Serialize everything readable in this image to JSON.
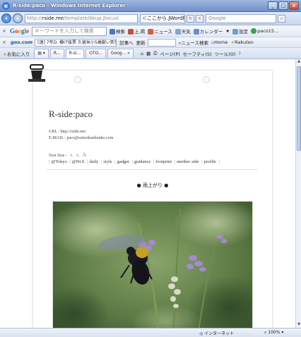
{
  "window": {
    "title": "R-side:paco - Windows Internet Explorer",
    "buttons": {
      "minimize": "_",
      "maximize": "□",
      "close": "×"
    }
  },
  "address": {
    "url_prefix": "http://",
    "url_host": "rside.me",
    "url_path": "/template/bkup.jbicusl",
    "hint": "＜ここから.JWord検索",
    "search_placeholder": "Google"
  },
  "google_toolbar": {
    "input_placeholder": "キーワードを入力して検索",
    "search_label": "検索",
    "items": [
      "上.掲",
      "ニュース",
      "天気",
      "カレンダー",
      "★",
      "設定",
      "paco15..."
    ]
  },
  "toolbar3": {
    "brand": "goo.com",
    "ticker": "[速] 7年D. 横げ抜票 久留米小5歳獣い死事",
    "label_a": "記事へ",
    "label_b": "更新",
    "news_search": "ニュース検索",
    "home": "Home",
    "rakuten": "Rakuten"
  },
  "tabbar": {
    "favorites": "お気に入り",
    "tabs": [
      "R...",
      "R-si...",
      "OTO...",
      "Goog..."
    ],
    "commands": [
      "ページ(P)",
      "セーフティ(S)",
      "ツール(O)"
    ]
  },
  "page": {
    "site_title": "R-side:paco",
    "url_label": "URL : http://rside.me/",
    "email_label": "E-MAIL : paco@suiseikanbunko.com",
    "text_size_label": "Text Size :",
    "text_size_options": [
      "A",
      "A",
      "A"
    ],
    "nav_items": [
      "@Tokyo",
      "@Nt.S",
      "daily",
      "style",
      "gadget",
      "guidance",
      "footprint",
      "another side",
      "profile"
    ],
    "pager_label": "雨上がり"
  },
  "status": {
    "zone": "インターネット",
    "zoom": "100%"
  },
  "colors": {
    "titlebar": "#6f8fc9",
    "page_bg": "#ffffff",
    "link": "#6a8fbf"
  }
}
